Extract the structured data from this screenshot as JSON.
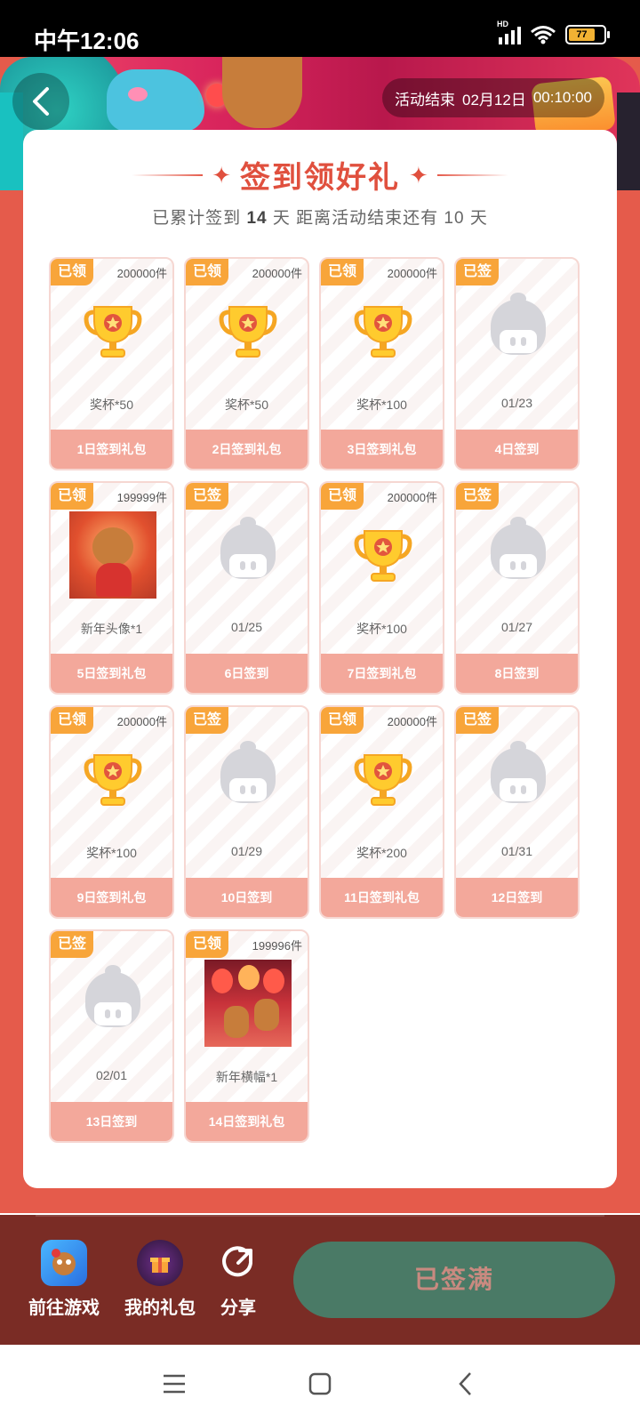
{
  "status_bar": {
    "time": "中午12:06",
    "network": "HD",
    "battery": "77"
  },
  "header": {
    "countdown_label": "活动结束",
    "countdown_date": "02月12日",
    "countdown_time": "00:10:00"
  },
  "card": {
    "title": "签到领好礼",
    "subtitle_prefix": "已累计签到",
    "signed_days": "14",
    "subtitle_mid": "天  距离活动结束还有",
    "remaining_days": "10",
    "subtitle_suffix": "天"
  },
  "tiles": [
    {
      "badge": "已领",
      "stock": "200000件",
      "name": "奖杯*50",
      "footer": "1日签到礼包",
      "image": "trophy-icon"
    },
    {
      "badge": "已领",
      "stock": "200000件",
      "name": "奖杯*50",
      "footer": "2日签到礼包",
      "image": "trophy-icon"
    },
    {
      "badge": "已领",
      "stock": "200000件",
      "name": "奖杯*100",
      "footer": "3日签到礼包",
      "image": "trophy-icon"
    },
    {
      "badge": "已签",
      "stock": "",
      "name": "01/23",
      "footer": "4日签到",
      "image": "placeholder-icon"
    },
    {
      "badge": "已领",
      "stock": "199999件",
      "name": "新年头像*1",
      "footer": "5日签到礼包",
      "image": "avatar-image"
    },
    {
      "badge": "已签",
      "stock": "",
      "name": "01/25",
      "footer": "6日签到",
      "image": "placeholder-icon"
    },
    {
      "badge": "已领",
      "stock": "200000件",
      "name": "奖杯*100",
      "footer": "7日签到礼包",
      "image": "trophy-icon"
    },
    {
      "badge": "已签",
      "stock": "",
      "name": "01/27",
      "footer": "8日签到",
      "image": "placeholder-icon"
    },
    {
      "badge": "已领",
      "stock": "200000件",
      "name": "奖杯*100",
      "footer": "9日签到礼包",
      "image": "trophy-icon"
    },
    {
      "badge": "已签",
      "stock": "",
      "name": "01/29",
      "footer": "10日签到",
      "image": "placeholder-icon"
    },
    {
      "badge": "已领",
      "stock": "200000件",
      "name": "奖杯*200",
      "footer": "11日签到礼包",
      "image": "trophy-icon"
    },
    {
      "badge": "已签",
      "stock": "",
      "name": "01/31",
      "footer": "12日签到",
      "image": "placeholder-icon"
    },
    {
      "badge": "已签",
      "stock": "",
      "name": "02/01",
      "footer": "13日签到",
      "image": "placeholder-icon"
    },
    {
      "badge": "已领",
      "stock": "199996件",
      "name": "新年横幅*1",
      "footer": "14日签到礼包",
      "image": "banner-image"
    }
  ],
  "bottom_bar": {
    "go_game": "前往游戏",
    "my_gifts": "我的礼包",
    "share": "分享",
    "signed_full": "已签满"
  },
  "colors": {
    "accent": "#e55b4b",
    "badge": "#f8a53a",
    "footer": "#f3a89b",
    "button": "#4a7a66",
    "bottom_bg": "#7a2c25"
  }
}
